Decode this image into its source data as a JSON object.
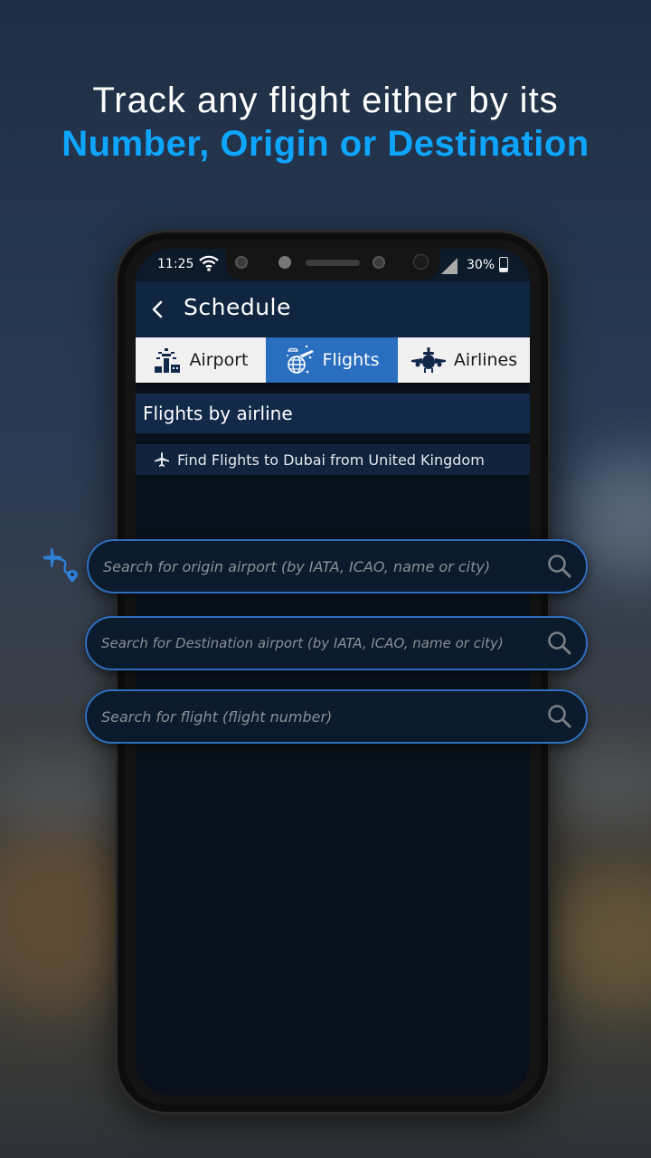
{
  "headline": {
    "line1": "Track any flight either by its",
    "line2": "Number, Origin or Destination"
  },
  "colors": {
    "accent_blue": "#0ea5ff",
    "tab_active": "#2a6ec0",
    "header_bg": "#0f2540",
    "field_border": "#2f6fbd"
  },
  "status_bar": {
    "time": "11:25",
    "battery": "30%",
    "icons": [
      "wifi-icon",
      "signal-icon",
      "battery-icon"
    ]
  },
  "app_header": {
    "title": "Schedule",
    "back_icon": "chevron-left-icon"
  },
  "tabs": [
    {
      "label": "Airport",
      "icon": "airport-tower-icon",
      "active": false
    },
    {
      "label": "Flights",
      "icon": "globe-plane-icon",
      "active": true
    },
    {
      "label": "Airlines",
      "icon": "airplane-front-icon",
      "active": false
    }
  ],
  "section": {
    "title": "Flights by airline",
    "find_link": "Find Flights to Dubai from United Kingdom"
  },
  "search_fields": {
    "origin_placeholder": "Search for origin airport (by IATA, ICAO, name or city)",
    "origin_value": "",
    "destination_placeholder": "Search for Destination airport (by IATA, ICAO, name or city)",
    "destination_value": "",
    "flight_placeholder": "Search for flight (flight number)",
    "flight_value": ""
  }
}
